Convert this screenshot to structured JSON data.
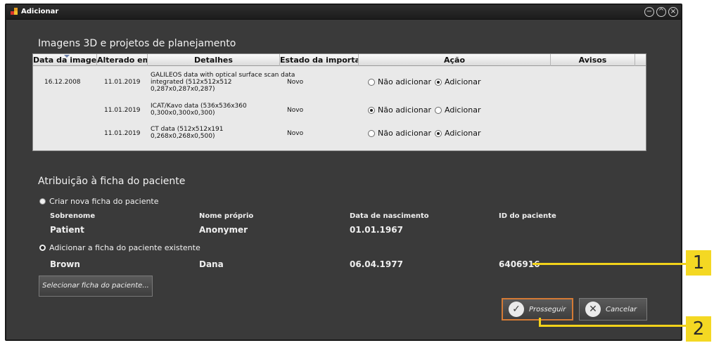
{
  "window": {
    "title": "Adicionar",
    "controls": [
      "minimize-icon",
      "maximize-icon",
      "close-icon"
    ]
  },
  "imports": {
    "section_title": "Imagens 3D e projetos de planejamento",
    "columns": [
      "Data da imagem",
      "Alterado em",
      "Detalhes",
      "Estado da importação",
      "Ação",
      "Avisos"
    ],
    "rows": [
      {
        "date": "16.12.2008",
        "modified": "11.01.2019",
        "details": "GALILEOS data with optical surface scan data\nintegrated (512x512x512\n0,287x0,287x0,287)",
        "status": "Novo",
        "opt_no": "Não adicionar",
        "opt_add": "Adicionar",
        "selected": "add"
      },
      {
        "date": "",
        "modified": "11.01.2019",
        "details": "ICAT/Kavo data (536x536x360\n0,300x0,300x0,300)",
        "status": "Novo",
        "opt_no": "Não adicionar",
        "opt_add": "Adicionar",
        "selected": "no"
      },
      {
        "date": "",
        "modified": "11.01.2019",
        "details": "CT data (512x512x191\n0,268x0,268x0,500)",
        "status": "Novo",
        "opt_no": "Não adicionar",
        "opt_add": "Adicionar",
        "selected": "add"
      }
    ]
  },
  "assignment": {
    "section_title": "Atribuição à ficha do paciente",
    "option_new": "Criar nova ficha do paciente",
    "option_existing": "Adicionar a ficha do paciente existente",
    "selected": "existing",
    "columns": {
      "surname": "Sobrenome",
      "given_name": "Nome próprio",
      "birth_date": "Data de nascimento",
      "patient_id": "ID do paciente"
    },
    "new_patient": {
      "surname": "Patient",
      "given_name": "Anonymer",
      "birth_date": "01.01.1967"
    },
    "existing_patient": {
      "surname": "Brown",
      "given_name": "Dana",
      "birth_date": "06.04.1977",
      "patient_id": "6406916"
    },
    "select_button": "Selecionar ficha do paciente..."
  },
  "buttons": {
    "proceed": "Prosseguir",
    "cancel": "Cancelar"
  },
  "callouts": [
    "1",
    "2"
  ],
  "colors": {
    "callout": "#f4d823",
    "primary_border": "#d47a35",
    "window_bg": "#3a3a3a"
  }
}
